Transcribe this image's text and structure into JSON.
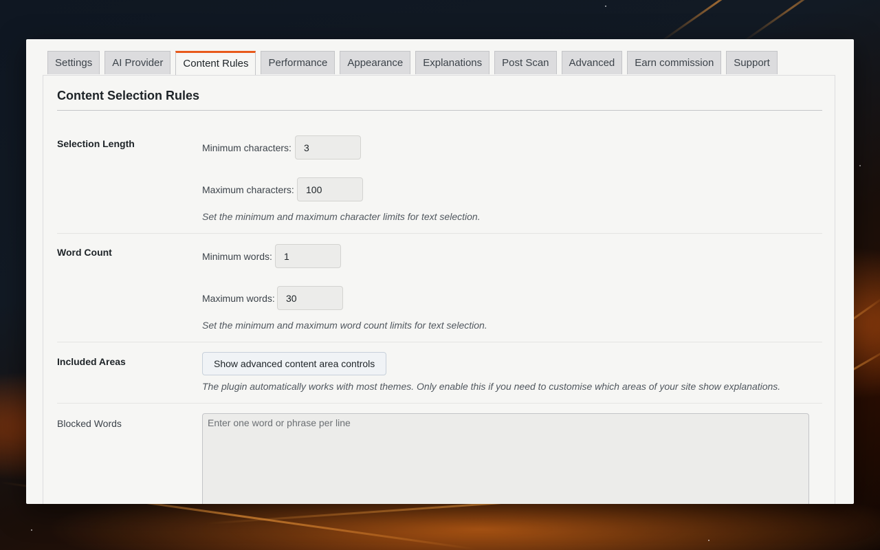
{
  "tabs": [
    {
      "label": "Settings"
    },
    {
      "label": "AI Provider"
    },
    {
      "label": "Content Rules",
      "active": true
    },
    {
      "label": "Performance"
    },
    {
      "label": "Appearance"
    },
    {
      "label": "Explanations"
    },
    {
      "label": "Post Scan"
    },
    {
      "label": "Advanced"
    },
    {
      "label": "Earn commission"
    },
    {
      "label": "Support"
    }
  ],
  "panel": {
    "title": "Content Selection Rules",
    "selection_length": {
      "label": "Selection Length",
      "min_label": "Minimum characters:",
      "min_value": "3",
      "max_label": "Maximum characters:",
      "max_value": "100",
      "help": "Set the minimum and maximum character limits for text selection."
    },
    "word_count": {
      "label": "Word Count",
      "min_label": "Minimum words:",
      "min_value": "1",
      "max_label": "Maximum words:",
      "max_value": "30",
      "help": "Set the minimum and maximum word count limits for text selection."
    },
    "included_areas": {
      "label": "Included Areas",
      "button_label": "Show advanced content area controls",
      "help": "The plugin automatically works with most themes. Only enable this if you need to customise which areas of your site show explanations."
    },
    "blocked_words": {
      "label": "Blocked Words",
      "placeholder": "Enter one word or phrase per line",
      "value": ""
    }
  },
  "colors": {
    "accent": "#e8591a",
    "tab_bg": "#dcdcde",
    "panel_bg": "#f6f6f4"
  }
}
